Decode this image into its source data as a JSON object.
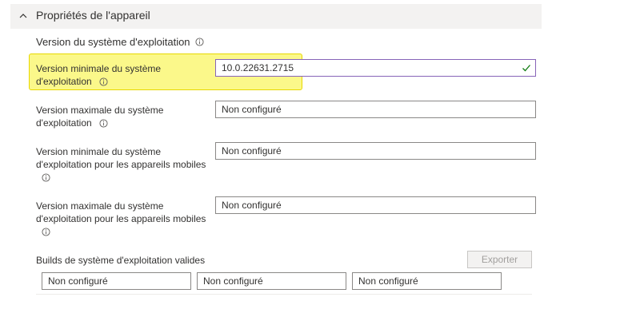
{
  "section": {
    "title": "Propriétés de l'appareil"
  },
  "os_version": {
    "heading": "Version du système d'exploitation"
  },
  "fields": {
    "min_os": {
      "label_line1": "Version minimale du système",
      "label_line2": "d'exploitation",
      "value": "10.0.22631.2715"
    },
    "max_os": {
      "label_line1": "Version maximale du système",
      "label_line2": "d'exploitation",
      "value": "Non configuré"
    },
    "min_mobile": {
      "label_line1": "Version minimale du système",
      "label_line2": "d'exploitation pour les appareils mobiles",
      "value": "Non configuré"
    },
    "max_mobile": {
      "label_line1": "Version maximale du système",
      "label_line2": "d'exploitation pour les appareils mobiles",
      "value": "Non configuré"
    }
  },
  "builds": {
    "label": "Builds de système d'exploitation valides",
    "export_label": "Exporter",
    "columns": [
      "Non configuré",
      "Non configuré",
      "Non configuré"
    ]
  },
  "colors": {
    "highlight": "#fbf88a",
    "valid_border": "#8764b8",
    "check": "#107c10"
  },
  "icons": [
    "chevron-up-icon",
    "info-icon",
    "checkmark-icon"
  ]
}
